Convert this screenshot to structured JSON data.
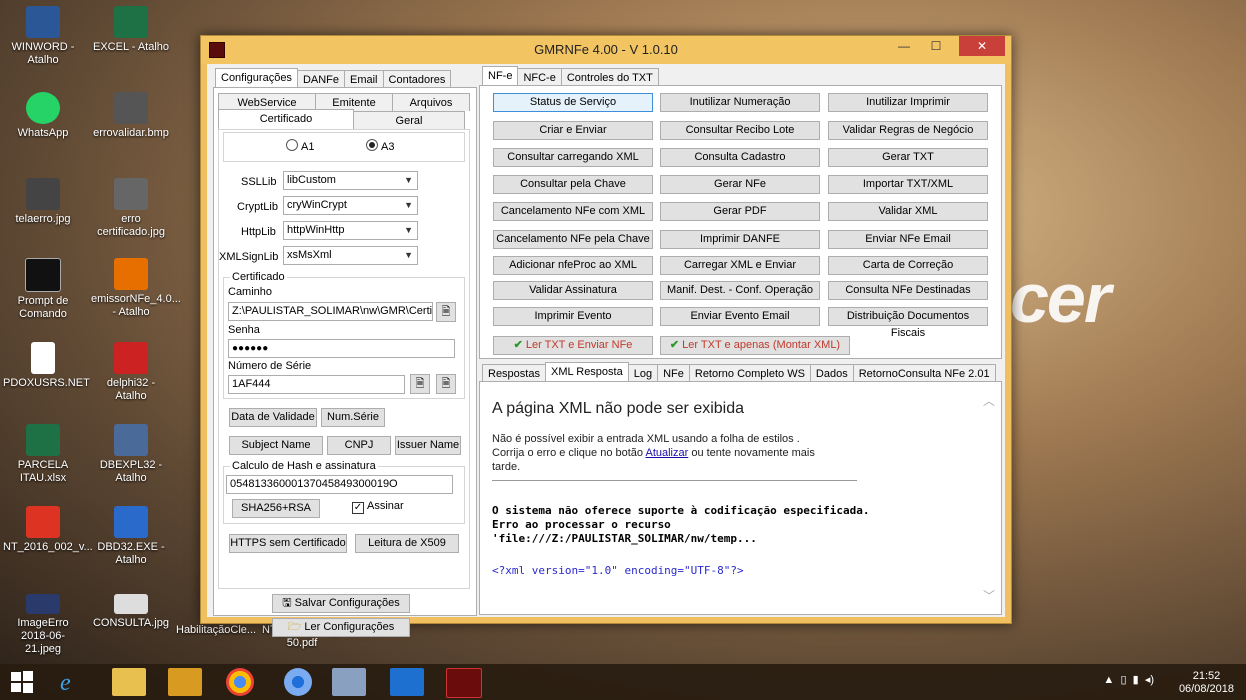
{
  "desktop_icons": [
    {
      "name": "WINWORD - Atalho",
      "icon": "word-icon"
    },
    {
      "name": "EXCEL - Atalho",
      "icon": "excel-icon"
    },
    {
      "name": "WhatsApp",
      "icon": "whatsapp-icon"
    },
    {
      "name": "errovalidar.bmp",
      "icon": "image-icon"
    },
    {
      "name": "telaerro.jpg",
      "icon": "image-icon"
    },
    {
      "name": "erro certificado.jpg",
      "icon": "image-icon"
    },
    {
      "name": "Prompt de Comando",
      "icon": "cmd-icon"
    },
    {
      "name": "emissorNFe_4.0... - Atalho",
      "icon": "java-icon"
    },
    {
      "name": "PDOXUSRS.NET",
      "icon": "file-icon"
    },
    {
      "name": "delphi32 - Atalho",
      "icon": "delphi-icon"
    },
    {
      "name": "PARCELA ITAU.xlsx",
      "icon": "excel-icon"
    },
    {
      "name": "DBEXPL32 - Atalho",
      "icon": "db-icon"
    },
    {
      "name": "NT_2016_002_v...",
      "icon": "pdf-icon"
    },
    {
      "name": "DBD32.EXE - Atalho",
      "icon": "db-icon"
    },
    {
      "name": "ImageErro 2018-06-21.jpeg",
      "icon": "image-icon"
    },
    {
      "name": "CONSULTA.jpg",
      "icon": "image-icon"
    },
    {
      "name": "HabilitaçãoCle...",
      "icon": "file-icon"
    },
    {
      "name": "NT_2016_002_v1 50.pdf",
      "icon": "pdf-icon"
    }
  ],
  "wallpaper_brand": "cer",
  "window": {
    "title": "GMRNFe 4.00 - V 1.0.10",
    "minimize": "—",
    "maximize": "☐",
    "close": "✕"
  },
  "left": {
    "tabs": [
      "Configurações",
      "DANFe",
      "Email",
      "Contadores"
    ],
    "subtabs_row1": [
      "WebService",
      "Emitente",
      "Arquivos"
    ],
    "subtabs_row2": [
      "Certificado",
      "Geral"
    ],
    "radio_a1": "A1",
    "radio_a3": "A3",
    "ssllib_label": "SSLLib",
    "ssllib_value": "libCustom",
    "cryptlib_label": "CryptLib",
    "cryptlib_value": "cryWinCrypt",
    "httplib_label": "HttpLib",
    "httplib_value": "httpWinHttp",
    "xmlsignlib_label": "XMLSignLib",
    "xmlsignlib_value": "xsMsXml",
    "cert_group": "Certificado",
    "caminho_label": "Caminho",
    "caminho_value": "Z:\\PAULISTAR_SOLIMAR\\nw\\GMR\\Certifica",
    "senha_label": "Senha",
    "senha_value": "●●●●●●",
    "serie_label": "Número de Série",
    "serie_value": "1AF444",
    "btn_data_validade": "Data de Validade",
    "btn_num_serie": "Num.Série",
    "btn_subject": "Subject Name",
    "btn_cnpj": "CNPJ",
    "btn_issuer": "Issuer Name",
    "hash_group": "Calculo de Hash e assinatura",
    "hash_value": "05481336000137045849300019O",
    "btn_sha": "SHA256+RSA",
    "assinar_label": "Assinar",
    "btn_https": "HTTPS sem Certificado",
    "btn_x509": "Leitura de X509",
    "btn_salvar": "Salvar Configurações",
    "btn_ler": "Ler Configurações"
  },
  "right": {
    "tabs": [
      "NF-e",
      "NFC-e",
      "Controles do TXT"
    ],
    "buttons": [
      [
        "Status de Serviço",
        "Inutilizar Numeração",
        "Inutilizar Imprimir"
      ],
      [
        "Criar e Enviar",
        "Consultar Recibo Lote",
        "Validar Regras de Negócio"
      ],
      [
        "Consultar carregando XML",
        "Consulta Cadastro",
        "Gerar TXT"
      ],
      [
        "Consultar pela Chave",
        "Gerar NFe",
        "Importar TXT/XML"
      ],
      [
        "Cancelamento NFe com XML",
        "Gerar PDF",
        "Validar XML"
      ],
      [
        "Cancelamento NFe pela Chave",
        "Imprimir DANFE",
        "Enviar NFe Email"
      ],
      [
        "Adicionar nfeProc ao XML",
        "Carregar XML e Enviar",
        "Carta de Correção"
      ],
      [
        "Validar Assinatura",
        "Manif. Dest. - Conf. Operação",
        "Consulta NFe Destinadas"
      ],
      [
        "Imprimir Evento",
        "Enviar Evento Email",
        "Distribuição Documentos Fiscais"
      ]
    ],
    "btn_ler_txt_enviar": "Ler TXT e Enviar NFe",
    "btn_ler_txt_montar": "Ler TXT e apenas (Montar XML)",
    "resp_tabs": [
      "Respostas",
      "XML Resposta",
      "Log",
      "NFe",
      "Retorno Completo WS",
      "Dados",
      "RetornoConsulta NFe 2.01"
    ],
    "xml_title": "A página XML não pode ser exibida",
    "xml_line1": "Não é possível exibir a entrada XML usando a folha de estilos .",
    "xml_line2_pre": "Corrija o erro e clique no botão ",
    "xml_line2_link": "Atualizar",
    "xml_line2_post": " ou tente novamente mais",
    "xml_line3": "tarde.",
    "err1": "O sistema não oferece suporte à codificação especificada.",
    "err2": "Erro ao processar o recurso",
    "err3": "'file:///Z:/PAULISTAR_SOLIMAR/nw/temp...",
    "xml_decl": "<?xml version=\"1.0\" encoding=\"UTF-8\"?>"
  },
  "taskbar": {
    "time": "21:52",
    "date": "06/08/2018",
    "tray_icons": [
      "up-arrow-icon",
      "battery-icon",
      "signal-icon",
      "volume-icon"
    ]
  },
  "colors": {
    "window_frame": "#f0c060",
    "close_button": "#c9403a",
    "check_green": "#2a9a2a",
    "button_face": "#e1e1e1"
  }
}
